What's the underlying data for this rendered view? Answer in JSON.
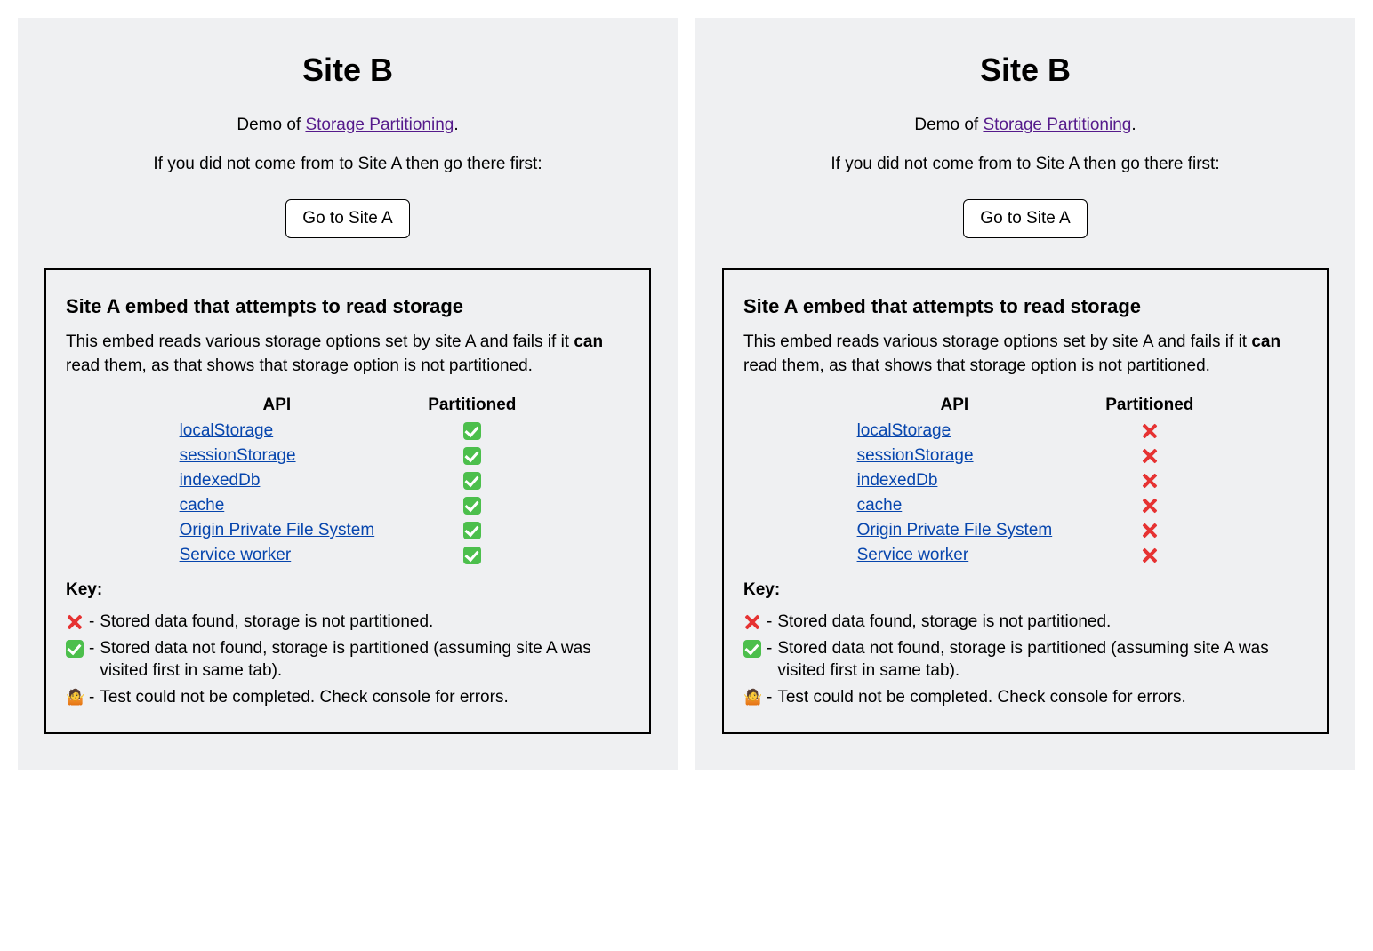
{
  "panels": [
    {
      "title": "Site B",
      "demo_prefix": "Demo of ",
      "demo_link_text": "Storage Partitioning",
      "demo_suffix": ".",
      "instruction": "If you did not come from to Site A then go there first:",
      "go_button": "Go to Site A",
      "embed": {
        "heading": "Site A embed that attempts to read storage",
        "desc_before": "This embed reads various storage options set by site A and fails if it ",
        "desc_bold": "can",
        "desc_after": " read them, as that shows that storage option is not partitioned.",
        "col_api": "API",
        "col_part": "Partitioned",
        "rows": [
          {
            "api": "localStorage",
            "status": "check"
          },
          {
            "api": "sessionStorage",
            "status": "check"
          },
          {
            "api": "indexedDb",
            "status": "check"
          },
          {
            "api": "cache",
            "status": "check"
          },
          {
            "api": "Origin Private File System",
            "status": "check"
          },
          {
            "api": "Service worker",
            "status": "check"
          }
        ],
        "key_label": "Key:",
        "key_items": [
          {
            "icon": "cross",
            "text": "Stored data found, storage is not partitioned."
          },
          {
            "icon": "check",
            "text": "Stored data not found, storage is partitioned (assuming site A was visited first in same tab)."
          },
          {
            "icon": "shrug",
            "text": "Test could not be completed. Check console for errors."
          }
        ]
      }
    },
    {
      "title": "Site B",
      "demo_prefix": "Demo of ",
      "demo_link_text": "Storage Partitioning",
      "demo_suffix": ".",
      "instruction": "If you did not come from to Site A then go there first:",
      "go_button": "Go to Site A",
      "embed": {
        "heading": "Site A embed that attempts to read storage",
        "desc_before": "This embed reads various storage options set by site A and fails if it ",
        "desc_bold": "can",
        "desc_after": " read them, as that shows that storage option is not partitioned.",
        "col_api": "API",
        "col_part": "Partitioned",
        "rows": [
          {
            "api": "localStorage",
            "status": "cross"
          },
          {
            "api": "sessionStorage",
            "status": "cross"
          },
          {
            "api": "indexedDb",
            "status": "cross"
          },
          {
            "api": "cache",
            "status": "cross"
          },
          {
            "api": "Origin Private File System",
            "status": "cross"
          },
          {
            "api": "Service worker",
            "status": "cross"
          }
        ],
        "key_label": "Key:",
        "key_items": [
          {
            "icon": "cross",
            "text": "Stored data found, storage is not partitioned."
          },
          {
            "icon": "check",
            "text": "Stored data not found, storage is partitioned (assuming site A was visited first in same tab)."
          },
          {
            "icon": "shrug",
            "text": "Test could not be completed. Check console for errors."
          }
        ]
      }
    }
  ]
}
